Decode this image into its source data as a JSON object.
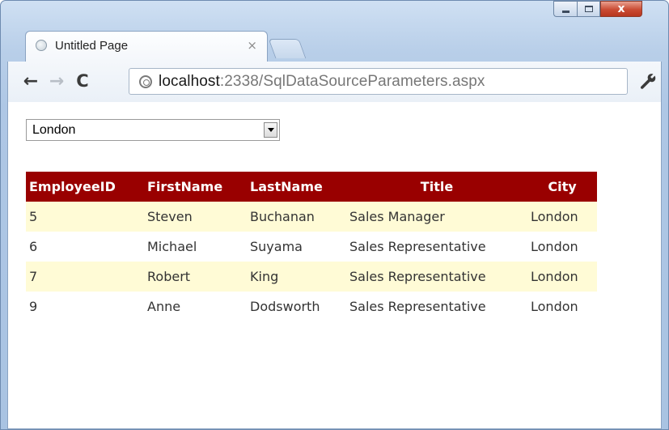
{
  "window": {
    "controls": {
      "minimize_icon": "minimize-icon",
      "maximize_icon": "maximize-icon",
      "close_glyph": "x"
    }
  },
  "tab": {
    "title": "Untitled Page",
    "close_glyph": "×"
  },
  "toolbar": {
    "back_glyph": "←",
    "forward_glyph": "→",
    "reload_glyph": "C",
    "url_host": "localhost",
    "url_path": ":2338/SqlDataSourceParameters.aspx"
  },
  "filter": {
    "selected_value": "London"
  },
  "grid": {
    "header_color": "#990000",
    "alt_row_color": "#fffbd6",
    "columns": [
      "EmployeeID",
      "FirstName",
      "LastName",
      "Title",
      "City"
    ],
    "rows": [
      [
        "5",
        "Steven",
        "Buchanan",
        "Sales Manager",
        "London"
      ],
      [
        "6",
        "Michael",
        "Suyama",
        "Sales Representative",
        "London"
      ],
      [
        "7",
        "Robert",
        "King",
        "Sales Representative",
        "London"
      ],
      [
        "9",
        "Anne",
        "Dodsworth",
        "Sales Representative",
        "London"
      ]
    ]
  }
}
